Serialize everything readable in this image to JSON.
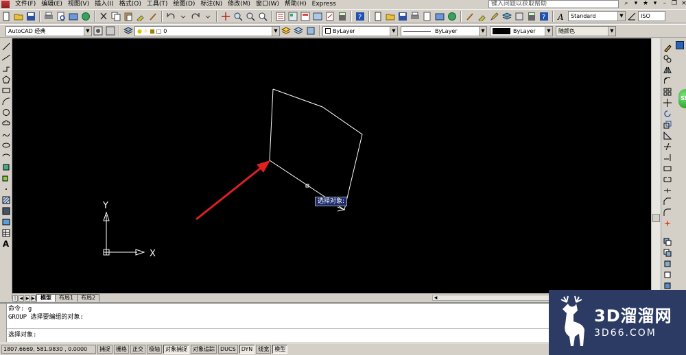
{
  "menubar": {
    "items": [
      "文件(F)",
      "编辑(E)",
      "视图(V)",
      "插入(I)",
      "格式(O)",
      "工具(T)",
      "绘图(D)",
      "标注(N)",
      "修改(M)",
      "窗口(W)",
      "帮助(H)",
      "Express"
    ],
    "help_search_placeholder": "键入问题以获取帮助"
  },
  "toolbar2": {
    "workspace": "AutoCAD 经典",
    "layer": "0",
    "color": "ByLayer",
    "linetype": "ByLayer",
    "lineweight": "ByLayer",
    "plotstyle": "随颜色"
  },
  "toolbar1": {
    "text_style": "Standard",
    "dim_style": "ISO"
  },
  "drawing": {
    "ucs_x_label": "X",
    "ucs_y_label": "Y",
    "tooltip": "选择对象:",
    "colors": {
      "background": "#000000",
      "geometry": "#ffffff",
      "arrow": "#e02020",
      "tooltip_bg": "#1d2a6b"
    }
  },
  "tabs": {
    "items": [
      "模型",
      "布局1",
      "布局2"
    ],
    "active": "模型"
  },
  "command": {
    "line1": "命令: g",
    "line2": "GROUP 选择要编组的对象:",
    "prompt": "选择对象:"
  },
  "statusbar": {
    "coords": "1807.6669, 581.9830 , 0.0000",
    "toggles": [
      {
        "label": "捕捉",
        "on": false
      },
      {
        "label": "栅格",
        "on": false
      },
      {
        "label": "正交",
        "on": false
      },
      {
        "label": "极轴",
        "on": false
      },
      {
        "label": "对象捕捉",
        "on": true
      },
      {
        "label": "对象追踪",
        "on": false
      },
      {
        "label": "DUCS",
        "on": false
      },
      {
        "label": "DYN",
        "on": true
      },
      {
        "label": "线宽",
        "on": false
      },
      {
        "label": "模型",
        "on": true
      }
    ]
  },
  "logo": {
    "main": "3D溜溜网",
    "sub": "3D66.COM"
  },
  "sidebar_badge": "Si"
}
